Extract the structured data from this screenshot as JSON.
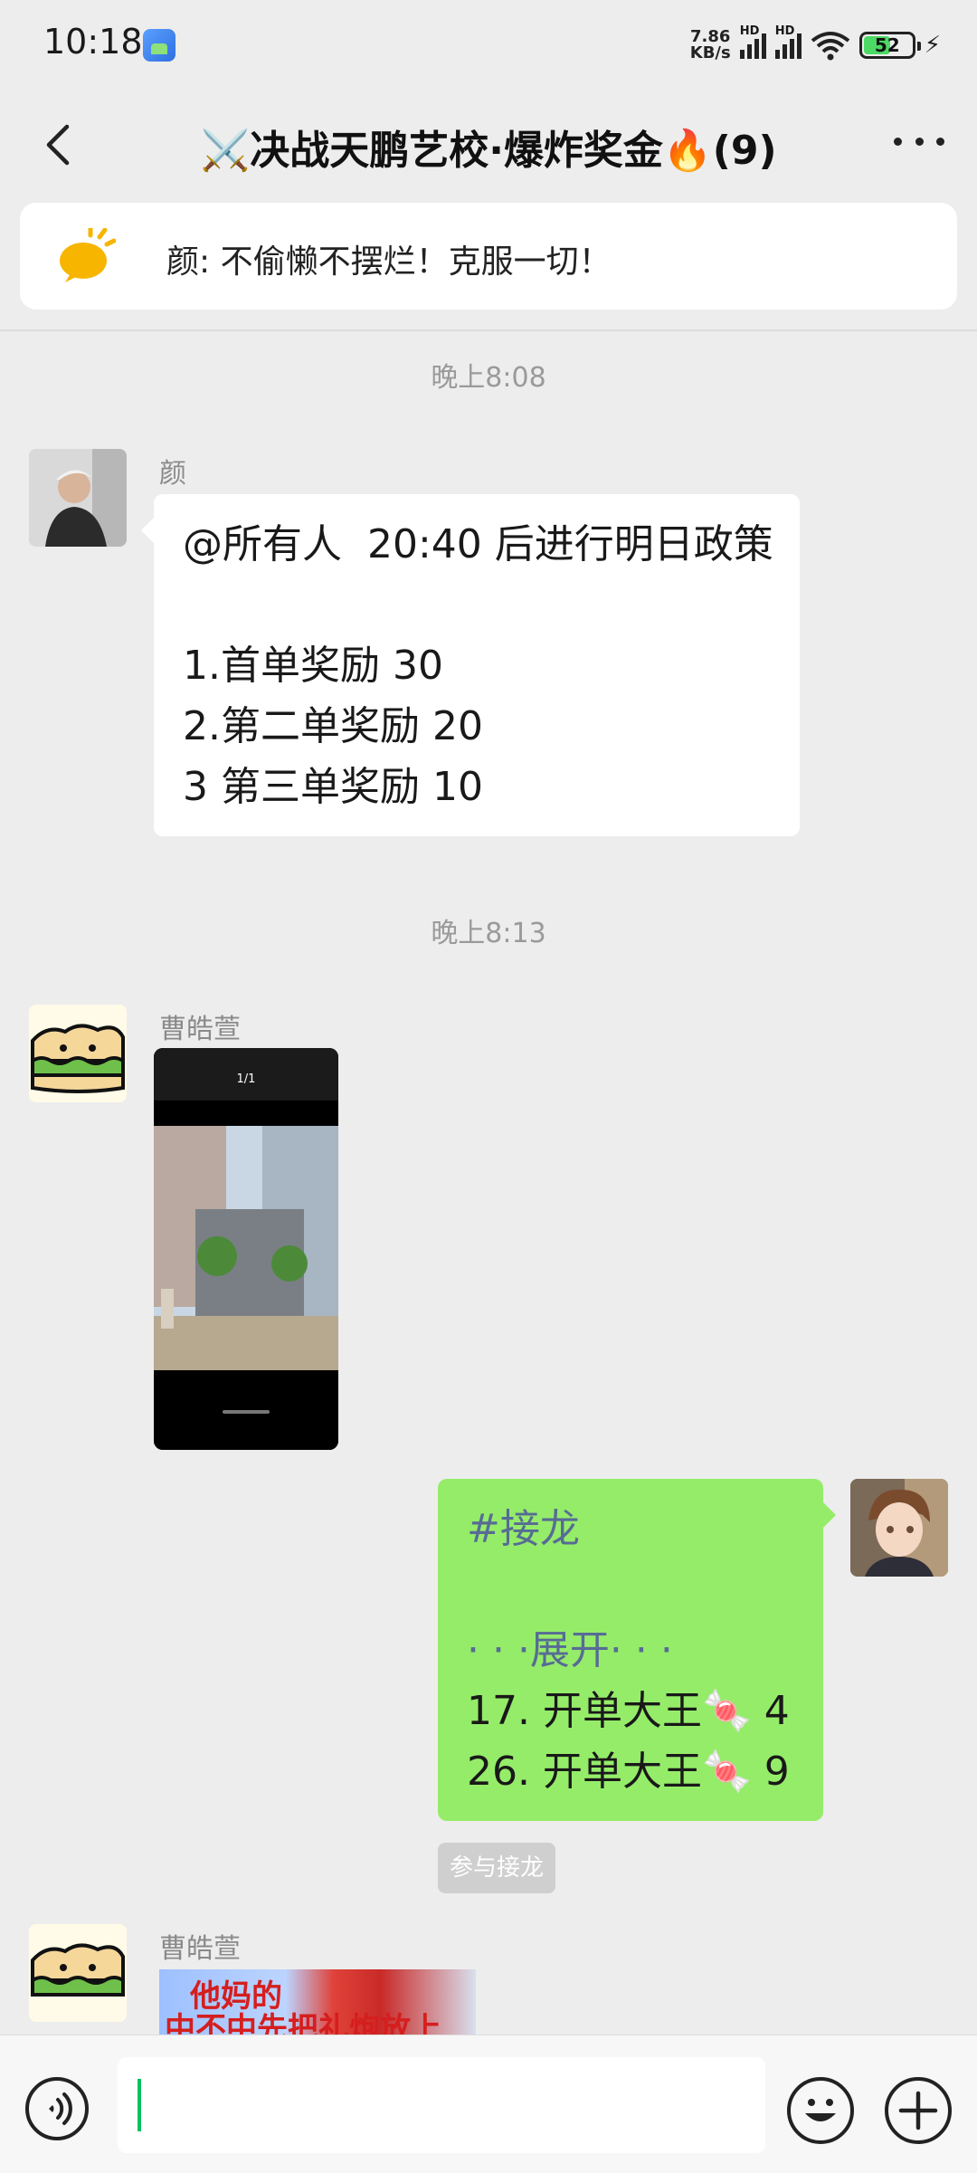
{
  "status_bar": {
    "time": "10:18",
    "net_speed_value": "7.86",
    "net_speed_unit": "KB/s",
    "signal_label": "HD",
    "battery": "52"
  },
  "header": {
    "title": "⚔️决战天鹏艺校·爆炸奖金🔥(9)"
  },
  "pinned": {
    "text": "颜: 不偷懒不摆烂！克服一切！"
  },
  "messages": {
    "time1": "晚上8:08",
    "m1_sender": "颜",
    "m1_lines": [
      "@所有人  20:40 后进行明日政策",
      "",
      "1.首单奖励 30",
      "2.第二单奖励 20",
      "3 第三单奖励 10"
    ],
    "time2": "晚上8:13",
    "m2_sender": "曹皓萱",
    "m3_lines": [
      "#接龙",
      "",
      "· · ·展开· · ·",
      "17. 开单大王🍬 4",
      "26. 开单大王🍬 9"
    ],
    "join_label": "参与接龙",
    "m4_sender": "曹皓萱",
    "m4_image_text_1": "他妈的",
    "m4_image_text_2": "中不中先把礼炮放上"
  },
  "photo": {
    "top_label": "1/1"
  },
  "input": {
    "value": ""
  }
}
